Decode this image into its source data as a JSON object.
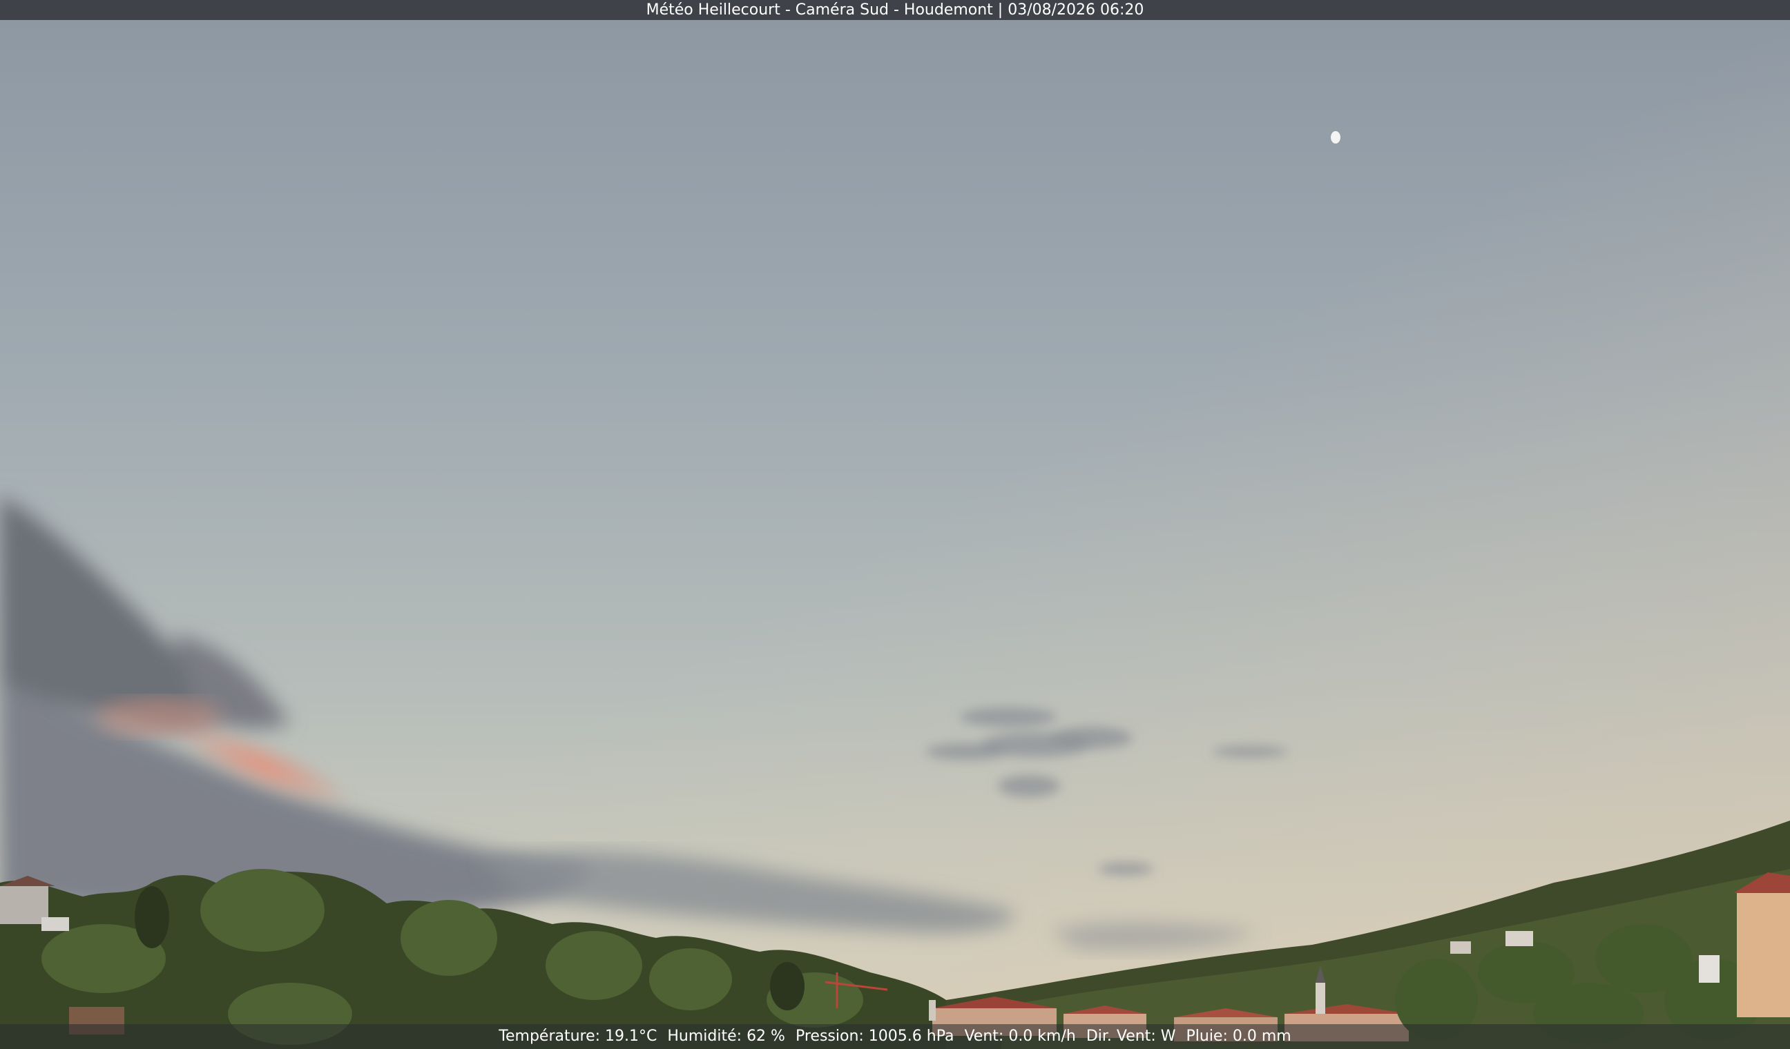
{
  "webcam": {
    "title": "Météo Heillecourt - Caméra Sud - Houdemont | 03/08/2026 06:20"
  },
  "weather": {
    "temperature": "Température: 19.1°C",
    "humidity": "Humidité: 62 %",
    "pressure": "Pression: 1005.6 hPa",
    "wind_speed": "Vent: 0.0 km/h",
    "wind_dir": "Dir. Vent: W",
    "rain": "Pluie: 0.0 mm"
  },
  "colors": {
    "sky_top": "#8f99a4",
    "sky_mid": "#aab5b9",
    "sky_horizon": "#d3d0bd",
    "cloud_dark": "#6d7078",
    "cloud_pink": "#d98e7c",
    "trees_dark": "#2f3b22",
    "trees_mid": "#4d5e2f",
    "roof_red": "#a14a3c"
  }
}
